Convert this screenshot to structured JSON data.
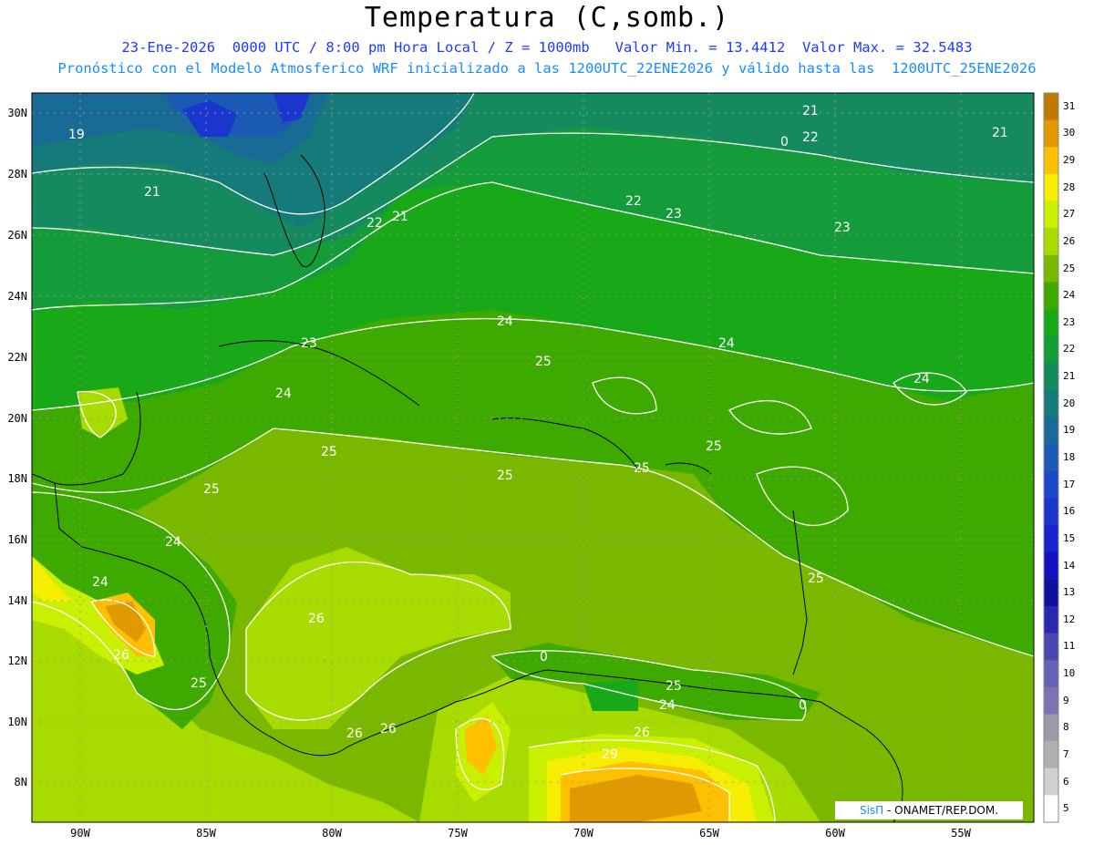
{
  "header": {
    "title": "Temperatura (C,somb.)",
    "line1": "23-Ene-2026  0000 UTC / 8:00 pm Hora Local / Z = 1000mb   Valor Min. = 13.4412  Valor Max. = 32.5483",
    "line2": "Pronóstico con el Modelo Atmosferico WRF inicializado a las 1200UTC_22ENE2026 y válido hasta las  1200UTC_25ENE2026"
  },
  "map": {
    "lat_labels": [
      "30N",
      "28N",
      "26N",
      "24N",
      "22N",
      "20N",
      "18N",
      "16N",
      "14N",
      "12N",
      "10N",
      "8N"
    ],
    "lon_labels": [
      "90W",
      "85W",
      "80W",
      "75W",
      "70W",
      "65W",
      "60W",
      "55W"
    ],
    "contour_labels": [
      "19",
      "21",
      "22",
      "22",
      "21",
      "23",
      "21",
      "22",
      "21",
      "23",
      "23",
      "24",
      "24",
      "24",
      "24",
      "25",
      "25",
      "25",
      "25",
      "25",
      "25",
      "24",
      "24",
      "25",
      "26",
      "26",
      "26",
      "26",
      "26",
      "25",
      "24",
      "25",
      "29",
      "0",
      "0",
      "0"
    ]
  },
  "colorbar": {
    "labels": [
      "31",
      "30",
      "29",
      "28",
      "27",
      "26",
      "25",
      "24",
      "23",
      "22",
      "21",
      "20",
      "19",
      "18",
      "17",
      "16",
      "15",
      "14",
      "13",
      "12",
      "11",
      "10",
      "9",
      "8",
      "7",
      "6",
      "5"
    ],
    "colors": [
      "#c07a00",
      "#e09a00",
      "#ffc000",
      "#f5ee00",
      "#c8f000",
      "#a8dc00",
      "#7ab800",
      "#3eaa00",
      "#18a818",
      "#149c3a",
      "#148a5e",
      "#157a7a",
      "#1a6a96",
      "#1b5ab4",
      "#1b48cc",
      "#1b36cc",
      "#1b22cc",
      "#1410c0",
      "#1010a0",
      "#2828b0",
      "#4848b0",
      "#6464b4",
      "#8070b4",
      "#9a9aa8",
      "#b0b0b0",
      "#d0d0d0",
      "#ffffff"
    ]
  },
  "credit": {
    "brand": "SisΠ",
    "text": " - ONAMET/REP.DOM."
  }
}
